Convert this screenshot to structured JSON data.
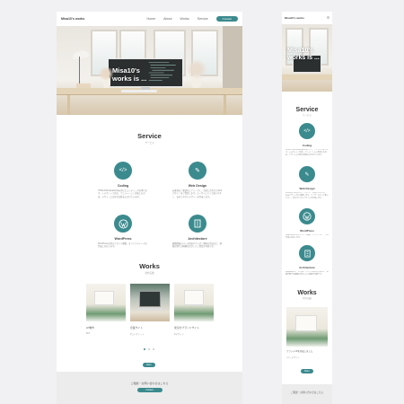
{
  "brand": "Misa10's works",
  "nav": {
    "items": [
      "Home",
      "About",
      "Works",
      "Service"
    ],
    "contact_label": "Contact"
  },
  "hero": {
    "title_line1": "Misa10's",
    "title_line2": "works is ..."
  },
  "service": {
    "title": "Service",
    "subtitle": "サービス",
    "items": [
      {
        "name": "Coding",
        "icon": "code-icon",
        "text": "HTML/CSS/JavaScriptを用いたコーディングを承ります。レスポンシブ対応、アニメーション実装にも対応。デザインに忠実な実装を心がけています。"
      },
      {
        "name": "Web Design",
        "icon": "pen-tool-icon",
        "text": "お客様のご要望をヒアリングし、目的に合わせたWebデザインをご提案します。ユーザーにとって使いやすく、伝わりやすいデザインを作成します。"
      },
      {
        "name": "WordPress",
        "icon": "wordpress-icon",
        "text": "WordPressを用いたサイト構築、オリジナルテーマの作成に対応します。"
      },
      {
        "name": "Architecture",
        "icon": "building-icon",
        "text": "建築関連のパース作成やプレゼン資料の作成など、建築分野での経験を活かしたご提案が可能です。"
      }
    ]
  },
  "works": {
    "title": "Works",
    "subtitle": "制作実績",
    "items": [
      {
        "title": "LP制作",
        "tag": "#LP"
      },
      {
        "title": "企業サイト",
        "tag": "#コーポレート"
      },
      {
        "title": "架空のブランドサイト",
        "tag": "#デザイン"
      }
    ],
    "more_label": "More",
    "mobile_item_title": "ブランドLPを作成しました",
    "mobile_item_tag": "#LP #デザイン"
  },
  "footer": {
    "text": "ご相談・お問い合わせはこちら",
    "button": "Contact"
  },
  "colors": {
    "accent": "#3b8a8e",
    "background": "#f1f1f3"
  }
}
